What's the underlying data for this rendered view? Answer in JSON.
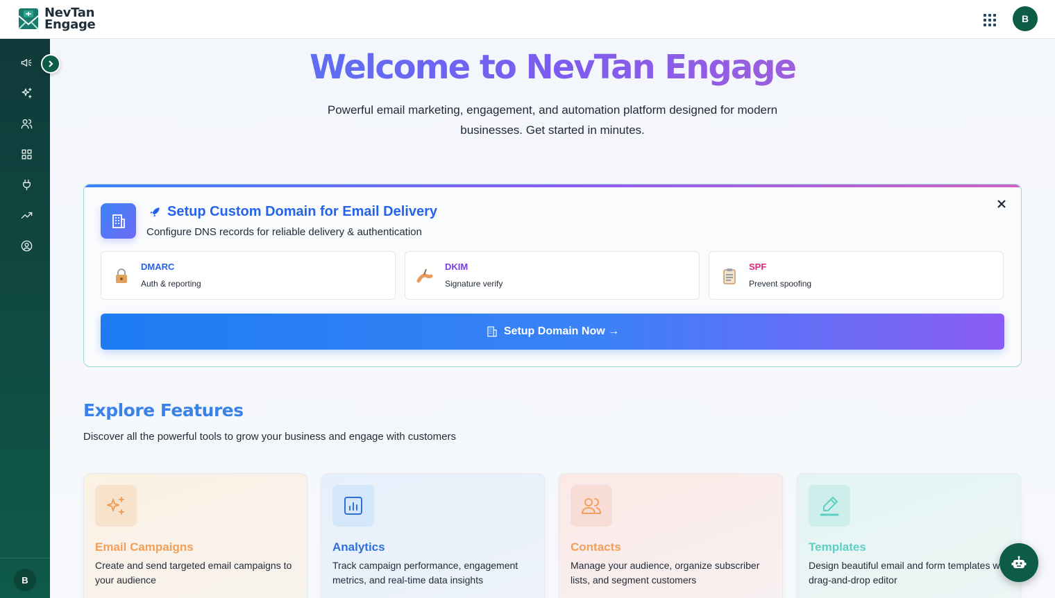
{
  "brand": {
    "line1": "NevTan",
    "line2": "Engage"
  },
  "user": {
    "initial": "B"
  },
  "hero": {
    "title": "Welcome to NevTan Engage",
    "subtitle": "Powerful email marketing, engagement, and automation platform designed for modern businesses. Get started in minutes."
  },
  "domain_card": {
    "title": "Setup Custom Domain for Email Delivery",
    "subtitle": "Configure DNS records for reliable delivery & authentication",
    "records": [
      {
        "name": "DMARC",
        "desc": "Auth & reporting",
        "color": "#2563eb",
        "icon": "lock-icon"
      },
      {
        "name": "DKIM",
        "desc": "Signature verify",
        "color": "#7c3aed",
        "icon": "signature-icon"
      },
      {
        "name": "SPF",
        "desc": "Prevent spoofing",
        "color": "#db2777",
        "icon": "clipboard-icon"
      }
    ],
    "button_label": "Setup Domain Now →"
  },
  "features": {
    "title": "Explore Features",
    "subtitle": "Discover all the powerful tools to grow your business and engage with customers",
    "cards": [
      {
        "name": "Email Campaigns",
        "desc": "Create and send targeted email campaigns to your audience",
        "color": "#f0a05a",
        "icon": "sparkles-icon"
      },
      {
        "name": "Analytics",
        "desc": "Track campaign performance, engagement metrics, and real-time data insights",
        "color": "#2f6fd6",
        "icon": "chart-icon"
      },
      {
        "name": "Contacts",
        "desc": "Manage your audience, organize subscriber lists, and segment customers",
        "color": "#f0a05a",
        "icon": "users-icon"
      },
      {
        "name": "Templates",
        "desc": "Design beautiful email and form templates with drag-and-drop editor",
        "color": "#5fcfc4",
        "icon": "pencil-icon"
      }
    ]
  },
  "sidebar": {
    "items": [
      "megaphone-icon",
      "sparkles-icon",
      "users-icon",
      "grid-icon",
      "plug-icon",
      "trend-icon",
      "user-circle-icon"
    ]
  }
}
